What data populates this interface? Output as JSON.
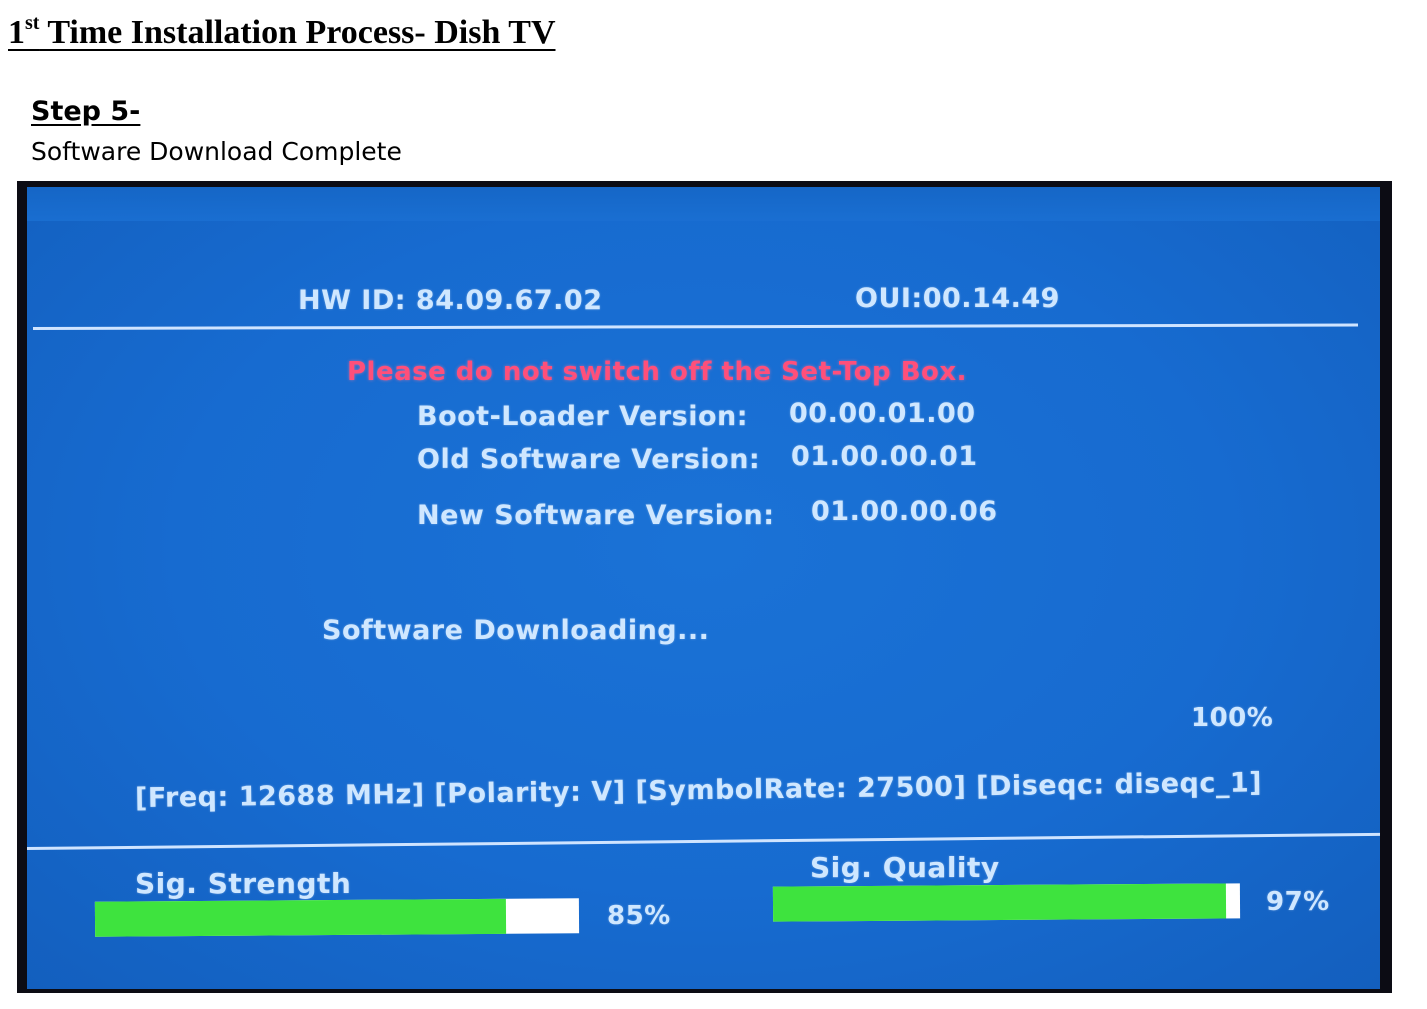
{
  "document": {
    "title_ordinal": "1",
    "title_ordinal_suffix": "st",
    "title_rest": " Time Installation Process- Dish TV",
    "step_heading": "Step 5-",
    "step_description": "Software Download Complete"
  },
  "osd": {
    "hw_id": "HW ID: 84.09.67.02",
    "oui": "OUI:00.14.49",
    "warning": "Please do not switch off the Set-Top Box.",
    "bootloader_label": "Boot-Loader Version:",
    "bootloader_value": "00.00.01.00",
    "old_sw_label": "Old Software Version:",
    "old_sw_value": "01.00.00.01",
    "new_sw_label": "New Software Version:",
    "new_sw_value": "01.00.00.06",
    "status": "Software Downloading...",
    "progress_text": "100%",
    "progress_value": 100,
    "tuning_info": "[Freq: 12688 MHz] [Polarity: V] [SymbolRate: 27500] [Diseqc: diseqc_1]",
    "signal_strength": {
      "label": "Sig. Strength",
      "value_text": "85%",
      "value": 85
    },
    "signal_quality": {
      "label": "Sig. Quality",
      "value_text": "97%",
      "value": 97
    }
  },
  "colors": {
    "screen_blue": "#176bd0",
    "osd_text": "#cfe7ff",
    "warning_text": "#ff4f7a",
    "bar_fill": "#3ee33e",
    "bar_track": "#ffffff"
  }
}
